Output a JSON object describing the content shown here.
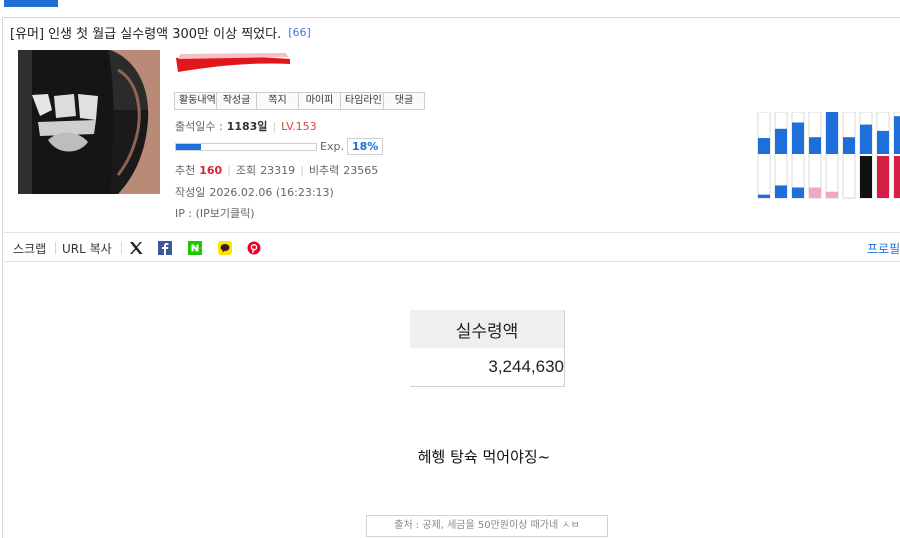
{
  "post": {
    "category": "[유머]",
    "title": "인생 첫 월급 실수령액 300만 이상 찍었다.",
    "comment_count": "[66]"
  },
  "author": {
    "actions": [
      "활동내역",
      "작성글",
      "쪽지",
      "마이피",
      "타임라인",
      "댓글"
    ],
    "attendance_label": "출석일수 :",
    "attendance_value": "1183일",
    "level": "LV.153",
    "exp_label": "Exp.",
    "exp_percent": "18%",
    "exp_fraction": 0.18,
    "recommend_label": "추천",
    "recommend_value": "160",
    "views_label": "조회",
    "views_value": "23319",
    "nonrec_label": "비추력",
    "nonrec_value": "23565",
    "written_label": "작성일",
    "written_value": "2026.02.06 (16:23:13)",
    "ip_text": "IP : (IP보기클릭)"
  },
  "activity_chart": {
    "type": "bar",
    "upper_values": [
      0.38,
      0.6,
      0.75,
      0.4,
      1.0,
      0.4,
      0.7,
      0.55,
      0.9
    ],
    "lower_values": [
      0.08,
      0.3,
      0.25,
      0.25,
      0.15,
      0.0,
      1.0,
      1.0,
      1.0
    ],
    "lower_colors": [
      "#1e6fd9",
      "#1e6fd9",
      "#1e6fd9",
      "#f2a7c3",
      "#f2a7c3",
      "#ffffff",
      "#111111",
      "#d61f45",
      "#d61f45"
    ],
    "upper_color": "#1e6fd9"
  },
  "share": {
    "scrap": "스크랩",
    "url_copy": "URL 복사",
    "profile": "프로필",
    "icons": [
      "x-icon",
      "facebook-icon",
      "naver-icon",
      "kakao-icon",
      "pinterest-icon"
    ]
  },
  "content": {
    "table_header": "실수령액",
    "table_value": "3,244,630",
    "body": "헤헹 탕슉 먹어야징~",
    "source": "출처 : 공제, 세금을 50만원이상 때가네 ㅅㅂ"
  },
  "colors": {
    "accent": "#1e6fd9",
    "level_red": "#d9463b",
    "comment_blue": "#3d7bd4"
  }
}
